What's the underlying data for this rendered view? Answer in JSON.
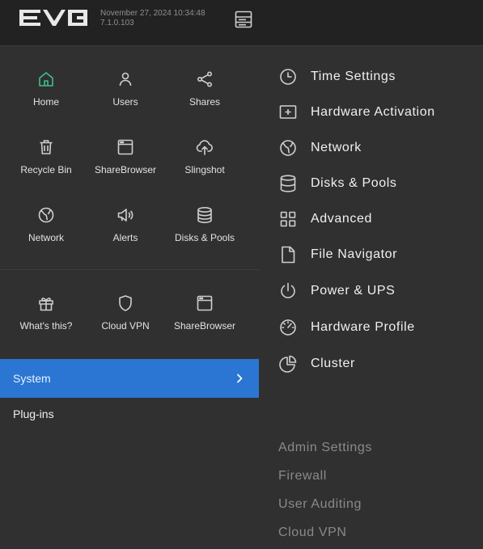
{
  "header": {
    "logo_text": "EVO",
    "datetime": "November 27, 2024 10:34:48",
    "version": "7.1.0.103",
    "menu_icon": "server-icon"
  },
  "apps_primary": [
    {
      "label": "Home",
      "icon": "home-icon"
    },
    {
      "label": "Users",
      "icon": "user-icon"
    },
    {
      "label": "Shares",
      "icon": "share-icon"
    },
    {
      "label": "Recycle Bin",
      "icon": "trash-icon"
    },
    {
      "label": "ShareBrowser",
      "icon": "browser-window-icon"
    },
    {
      "label": "Slingshot",
      "icon": "cloud-upload-icon"
    },
    {
      "label": "Network",
      "icon": "globe-icon"
    },
    {
      "label": "Alerts",
      "icon": "megaphone-icon"
    },
    {
      "label": "Disks & Pools",
      "icon": "database-icon"
    }
  ],
  "apps_secondary": [
    {
      "label": "What's this?",
      "icon": "gift-icon"
    },
    {
      "label": "Cloud VPN",
      "icon": "shield-icon"
    },
    {
      "label": "ShareBrowser",
      "icon": "browser-window-icon"
    }
  ],
  "nav": {
    "system": "System",
    "plugins": "Plug-ins"
  },
  "system_menu": [
    {
      "label": "Time Settings",
      "icon": "clock-icon"
    },
    {
      "label": "Hardware Activation",
      "icon": "plus-box-icon"
    },
    {
      "label": "Network",
      "icon": "globe-icon"
    },
    {
      "label": "Disks & Pools",
      "icon": "database-icon"
    },
    {
      "label": "Advanced",
      "icon": "grid-icon"
    },
    {
      "label": "File Navigator",
      "icon": "file-icon"
    },
    {
      "label": "Power & UPS",
      "icon": "power-icon"
    },
    {
      "label": "Hardware Profile",
      "icon": "gauge-icon"
    },
    {
      "label": "Cluster",
      "icon": "pie-chart-icon"
    }
  ],
  "admin_links": [
    "Admin Settings",
    "Firewall",
    "User Auditing",
    "Cloud VPN"
  ],
  "colors": {
    "accent": "#2a76d2",
    "home_icon": "#3fbf8a",
    "header_bg": "#222222",
    "panel_bg": "#303030"
  }
}
